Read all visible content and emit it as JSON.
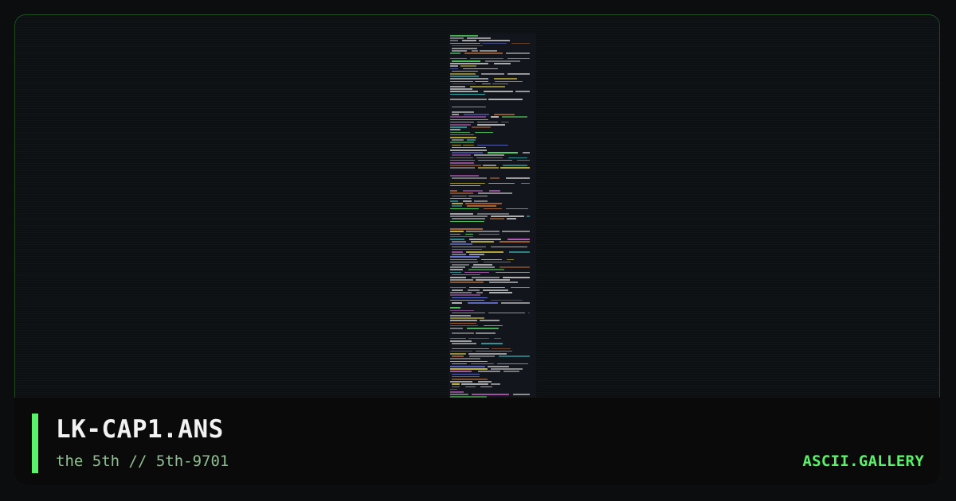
{
  "artwork": {
    "title": "LK-CAP1.ANS",
    "subtitle": "the 5th // 5th-9701",
    "preview_text_colors": [
      "#cfcfcf",
      "#3fd4d4",
      "#d46ad4",
      "#e0d040",
      "#5cf16a",
      "#d47a3a",
      "#7a8aff"
    ]
  },
  "brand": {
    "label": "ASCII.GALLERY",
    "color": "#5cf16a"
  },
  "theme": {
    "accent": "#5cf16a",
    "border": "#1f4a22",
    "background": "#0b0d0f"
  }
}
